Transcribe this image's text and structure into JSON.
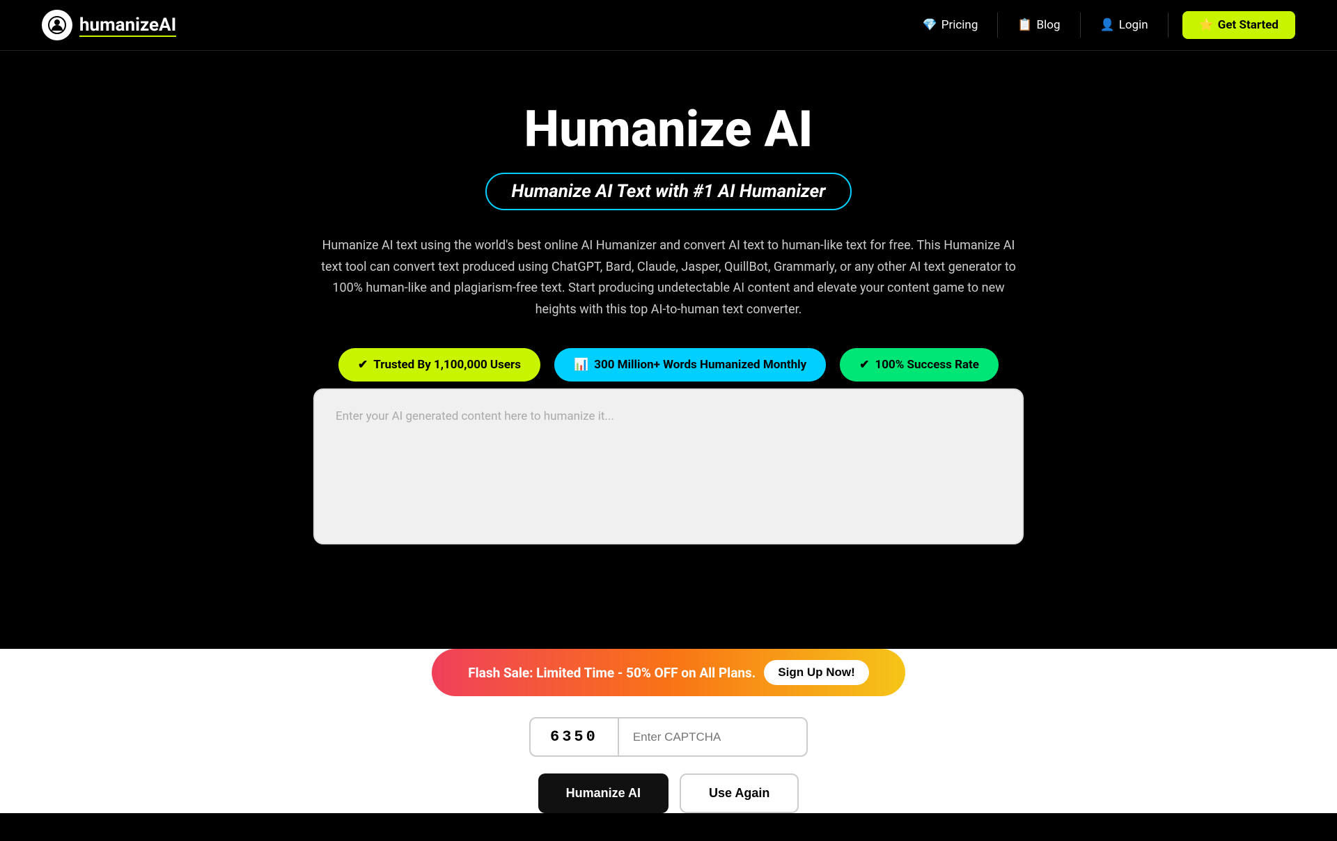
{
  "nav": {
    "logo_text_main": "humanize",
    "logo_text_accent": "AI",
    "pricing_label": "Pricing",
    "blog_label": "Blog",
    "login_label": "Login",
    "cta_label": "Get Started"
  },
  "hero": {
    "title": "Humanize AI",
    "subtitle": "Humanize AI Text with #1 AI Humanizer",
    "description": "Humanize AI text using the world's best online AI Humanizer and convert AI text to human-like text for free. This Humanize AI text tool can convert text produced using ChatGPT, Bard, Claude, Jasper, QuillBot, Grammarly, or any other AI text generator to 100% human-like and plagiarism-free text. Start producing undetectable AI content and elevate your content game to new heights with this top AI-to-human text converter.",
    "badge1": "Trusted By 1,100,000 Users",
    "badge2": "300 Million+ Words Humanized Monthly",
    "badge3": "100% Success Rate"
  },
  "textarea": {
    "placeholder": "Enter your AI generated content here to humanize it..."
  },
  "flash_sale": {
    "text": "Flash Sale: Limited Time - 50% OFF on All Plans.",
    "btn_label": "Sign Up Now!"
  },
  "captcha": {
    "code": "6350",
    "placeholder": "Enter CAPTCHA"
  },
  "buttons": {
    "humanize_label": "Humanize AI",
    "use_again_label": "Use Again"
  }
}
